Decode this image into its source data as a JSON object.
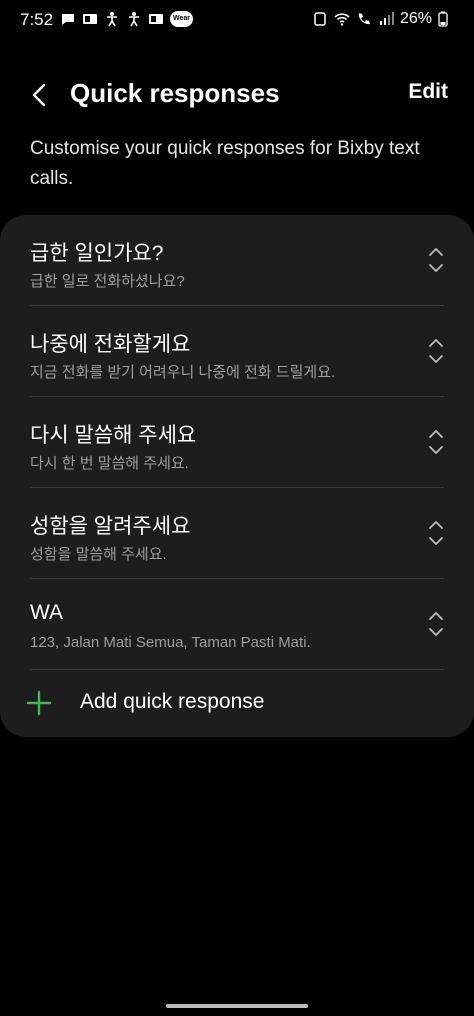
{
  "status": {
    "time": "7:52",
    "battery": "26%",
    "wear_label": "Wear"
  },
  "header": {
    "title": "Quick responses",
    "edit_label": "Edit"
  },
  "description": "Customise your quick responses for Bixby text calls.",
  "responses": [
    {
      "title": "급한 일인가요?",
      "subtitle": "급한 일로 전화하셨나요?"
    },
    {
      "title": "나중에 전화할게요",
      "subtitle": "지금 전화를 받기 어려우니 나중에 전화 드릴게요."
    },
    {
      "title": "다시 말씀해 주세요",
      "subtitle": "다시 한 번 말씀해 주세요."
    },
    {
      "title": "성함을 알려주세요",
      "subtitle": "성함을 말씀해 주세요."
    },
    {
      "title": "WA",
      "subtitle": "123, Jalan Mati Semua, Taman Pasti Mati."
    }
  ],
  "add_label": "Add quick response",
  "colors": {
    "accent": "#3dbd4c",
    "card": "#1d1d1d",
    "subtext": "#9d9d9d"
  }
}
